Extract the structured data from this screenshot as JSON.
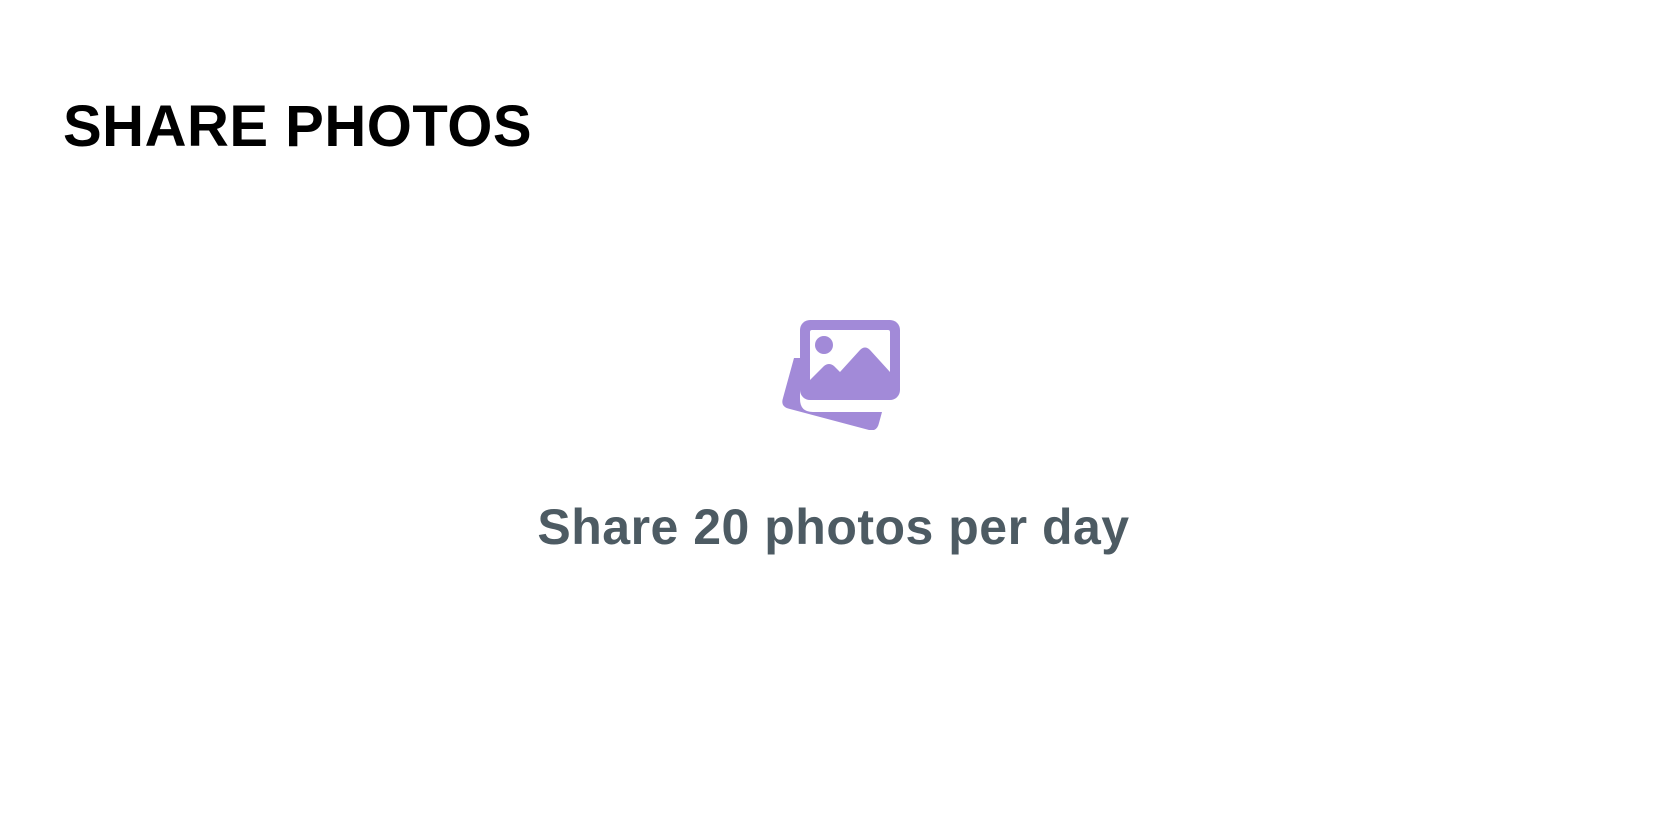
{
  "page": {
    "title": "SHARE PHOTOS"
  },
  "feature": {
    "icon": "photos-icon",
    "text": "Share 20 photos per day"
  },
  "colors": {
    "icon": "#a28ad8",
    "text": "#4d5b63",
    "title": "#000000",
    "background": "#ffffff"
  }
}
